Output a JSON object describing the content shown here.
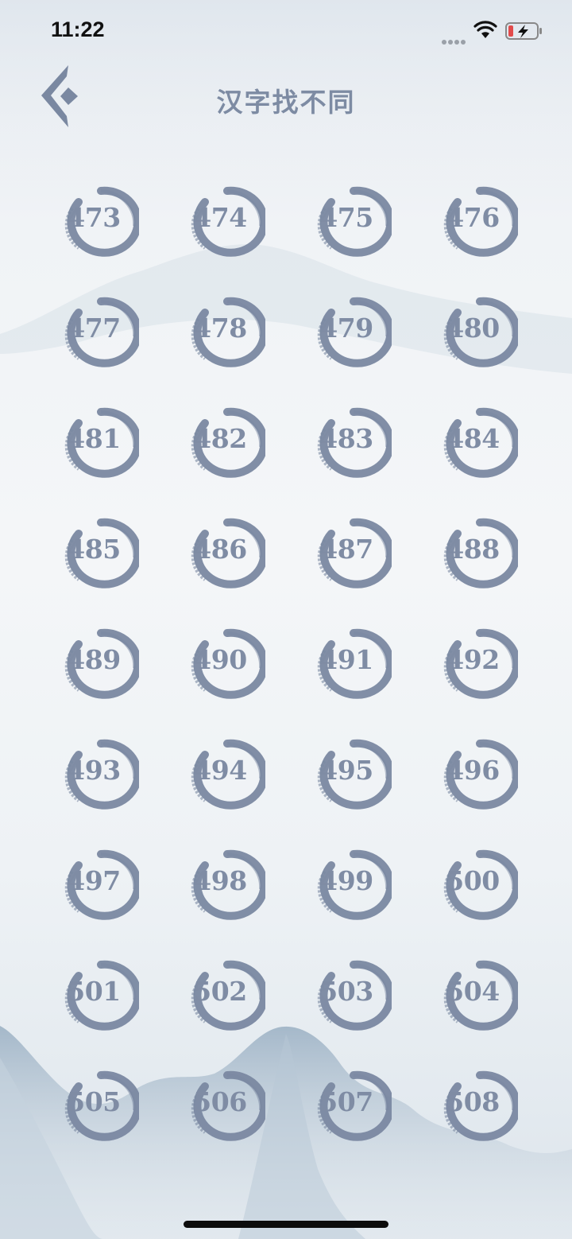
{
  "status_bar": {
    "time": "11:22",
    "signal_icon": "signal-dots-icon",
    "wifi_icon": "wifi-icon",
    "battery_icon": "battery-charging-icon",
    "battery_color": "#e24b4b"
  },
  "header": {
    "title": "汉字找不同",
    "back_icon": "back-arrow-icon"
  },
  "levels": [
    "473",
    "474",
    "475",
    "476",
    "477",
    "478",
    "479",
    "480",
    "481",
    "482",
    "483",
    "484",
    "485",
    "486",
    "487",
    "488",
    "489",
    "490",
    "491",
    "492",
    "493",
    "494",
    "495",
    "496",
    "497",
    "498",
    "499",
    "500",
    "501",
    "502",
    "503",
    "504",
    "505",
    "506",
    "507",
    "508"
  ],
  "colors": {
    "ink": "#7a88a1",
    "title": "#7d8ba3",
    "background": "#eef2f5",
    "mountain": "#a9bccd"
  }
}
